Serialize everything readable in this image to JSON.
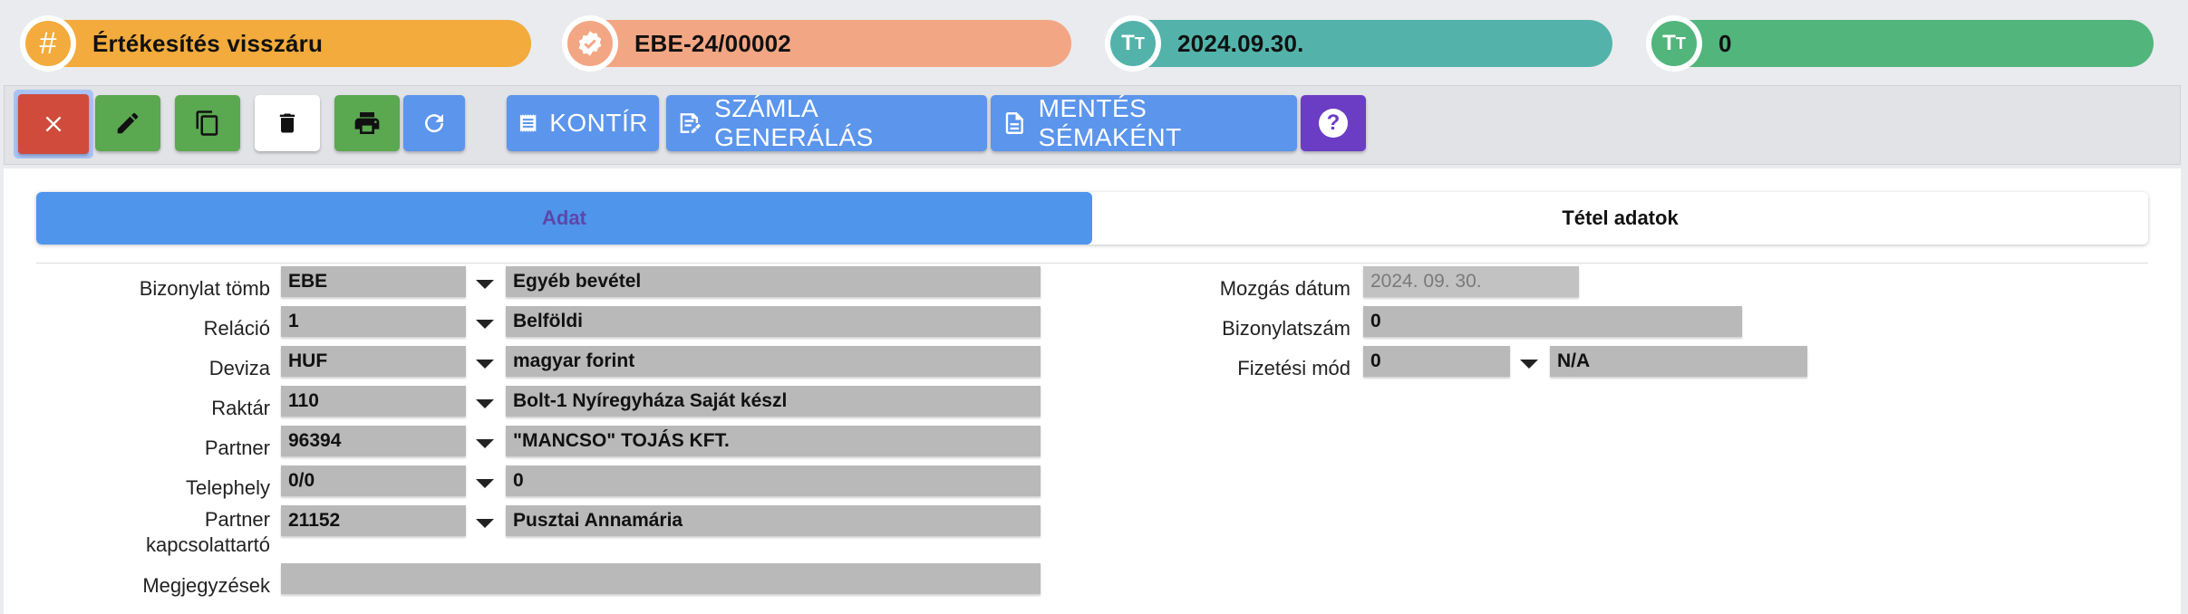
{
  "header": {
    "type_label": "Értékesítés visszáru",
    "doc_number": "EBE-24/00002",
    "date": "2024.09.30.",
    "count": "0"
  },
  "toolbar": {
    "kontir_label": "KONTÍR",
    "invoice_label": "SZÁMLA GENERÁLÁS",
    "save_schema_label": "MENTÉS SÉMAKÉNT",
    "help_label": "?"
  },
  "tabs": {
    "data": "Adat",
    "items": "Tétel adatok"
  },
  "form": {
    "bizonylat_tomb": {
      "label": "Bizonylat tömb",
      "code": "EBE",
      "name": "Egyéb bevétel"
    },
    "relacio": {
      "label": "Reláció",
      "code": "1",
      "name": "Belföldi"
    },
    "deviza": {
      "label": "Deviza",
      "code": "HUF",
      "name": "magyar forint"
    },
    "raktar": {
      "label": "Raktár",
      "code": "110",
      "name": "Bolt-1 Nyíregyháza Saját készl"
    },
    "partner": {
      "label": "Partner",
      "code": "96394",
      "name": "\"MANCSO\" TOJÁS KFT."
    },
    "telephely": {
      "label": "Telephely",
      "code": "0/0",
      "name": "0"
    },
    "kapcsolattarto": {
      "label_line1": "Partner",
      "label_line2": "kapcsolattartó",
      "code": "21152",
      "name": "Pusztai Annamária"
    },
    "megjegyzesek": {
      "label": "Megjegyzések",
      "value": ""
    },
    "mozgas_datum": {
      "label": "Mozgás dátum",
      "value": "2024. 09. 30."
    },
    "bizonylatszam": {
      "label": "Bizonylatszám",
      "value": "0"
    },
    "fizetesi_mod": {
      "label": "Fizetési mód",
      "code": "0",
      "name": "N/A"
    }
  },
  "colors": {
    "orange": "#f2ab3c",
    "salmon": "#f3a683",
    "teal": "#53b3ab",
    "green": "#52b57c",
    "close_red": "#d04b3b",
    "action_green": "#5aa850",
    "action_blue": "#5b95ec",
    "help_purple": "#6b3cc4"
  }
}
